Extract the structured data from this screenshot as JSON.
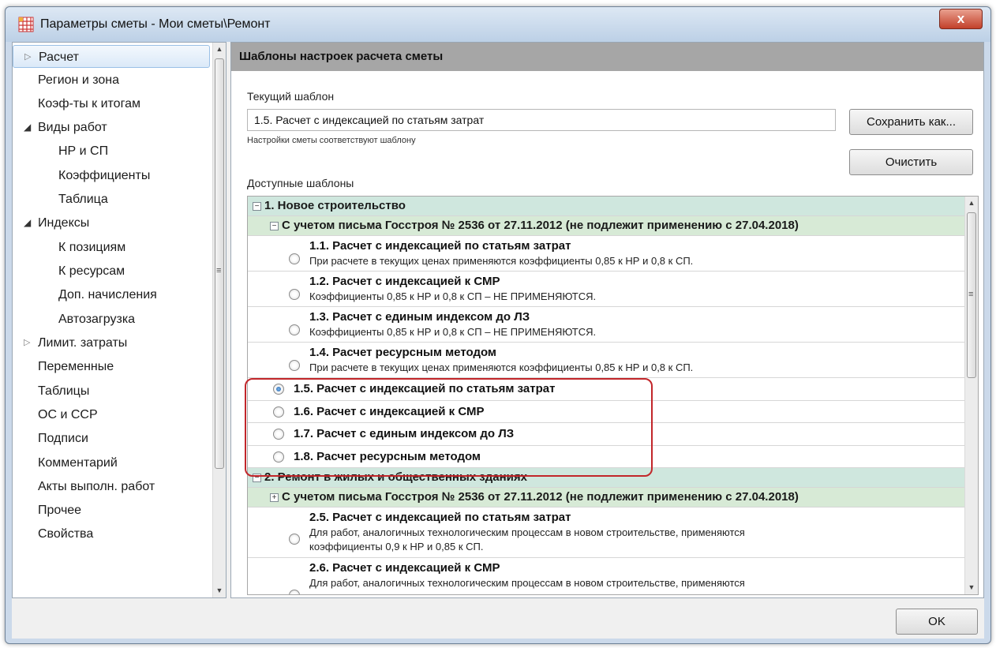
{
  "window": {
    "title": "Параметры сметы - Мои сметы\\Ремонт",
    "close_label": "x"
  },
  "sidebar": {
    "items": [
      {
        "label": "Расчет",
        "level": 0,
        "arrow": "▷",
        "selected": true
      },
      {
        "label": "Регион и зона",
        "level": 0,
        "arrow": ""
      },
      {
        "label": "Коэф-ты к итогам",
        "level": 0,
        "arrow": ""
      },
      {
        "label": "Виды работ",
        "level": 0,
        "arrow": "◢"
      },
      {
        "label": "НР и СП",
        "level": 1,
        "arrow": ""
      },
      {
        "label": "Коэффициенты",
        "level": 1,
        "arrow": ""
      },
      {
        "label": "Таблица",
        "level": 1,
        "arrow": ""
      },
      {
        "label": "Индексы",
        "level": 0,
        "arrow": "◢"
      },
      {
        "label": "К позициям",
        "level": 1,
        "arrow": ""
      },
      {
        "label": "К ресурсам",
        "level": 1,
        "arrow": ""
      },
      {
        "label": "Доп. начисления",
        "level": 1,
        "arrow": ""
      },
      {
        "label": "Автозагрузка",
        "level": 1,
        "arrow": ""
      },
      {
        "label": "Лимит. затраты",
        "level": 0,
        "arrow": "▷"
      },
      {
        "label": "Переменные",
        "level": 0,
        "arrow": ""
      },
      {
        "label": "Таблицы",
        "level": 0,
        "arrow": ""
      },
      {
        "label": "ОС и ССР",
        "level": 0,
        "arrow": ""
      },
      {
        "label": "Подписи",
        "level": 0,
        "arrow": ""
      },
      {
        "label": "Комментарий",
        "level": 0,
        "arrow": ""
      },
      {
        "label": "Акты выполн. работ",
        "level": 0,
        "arrow": ""
      },
      {
        "label": "Прочее",
        "level": 0,
        "arrow": ""
      },
      {
        "label": "Свойства",
        "level": 0,
        "arrow": ""
      }
    ]
  },
  "panel": {
    "header": "Шаблоны настроек расчета сметы",
    "current_label": "Текущий шаблон",
    "current_value": "1.5. Расчет с индексацией по статьям затрат",
    "note": "Настройки сметы соответствуют шаблону",
    "save_as_label": "Сохранить как...",
    "clear_label": "Очистить",
    "available_label": "Доступные шаблоны"
  },
  "tree": {
    "group1": "1. Новое строительство",
    "sub1": "С учетом письма Госстроя № 2536 от 27.11.2012 (не подлежит применению с 27.04.2018)",
    "options_detailed": [
      {
        "title": "1.1. Расчет с индексацией по статьям затрат",
        "desc": "При расчете в текущих ценах применяются коэффициенты 0,85 к НР и 0,8 к СП."
      },
      {
        "title": "1.2. Расчет с индексацией к СМР",
        "desc": "Коэффициенты 0,85 к НР и 0,8 к СП – НЕ ПРИМЕНЯЮТСЯ."
      },
      {
        "title": "1.3. Расчет с единым индексом до ЛЗ",
        "desc": "Коэффициенты 0,85 к НР и 0,8 к СП – НЕ ПРИМЕНЯЮТСЯ."
      },
      {
        "title": "1.4. Расчет ресурсным методом",
        "desc": "При расчете в текущих ценах применяются коэффициенты 0,85 к НР и 0,8 к СП."
      }
    ],
    "options_simple": [
      {
        "title": "1.5. Расчет с индексацией по статьям затрат",
        "checked": true
      },
      {
        "title": "1.6. Расчет с индексацией к СМР",
        "checked": false
      },
      {
        "title": "1.7. Расчет с единым индексом до ЛЗ",
        "checked": false
      },
      {
        "title": "1.8. Расчет ресурсным методом",
        "checked": false
      }
    ],
    "group2": "2. Ремонт в жилых и общественных зданиях",
    "sub2": "С учетом письма Госстроя № 2536 от 27.11.2012 (не подлежит применению с 27.04.2018)",
    "opt25_title": "2.5. Расчет с индексацией по статьям затрат",
    "opt25_desc1": "Для работ, аналогичных технологическим процессам в новом строительстве, применяются",
    "opt25_desc2": "коэффициенты 0,9 к НР и 0,85 к СП.",
    "opt26_title": "2.6. Расчет с индексацией к СМР",
    "opt26_desc": "Для работ, аналогичных технологическим процессам в новом строительстве, применяются"
  },
  "footer": {
    "ok_label": "OK"
  },
  "colors": {
    "group1_bg": "#cfe7de",
    "group2_bg": "#d7ead6",
    "highlight_border": "#c2262a",
    "panel_header_bg": "#a6a6a6"
  }
}
